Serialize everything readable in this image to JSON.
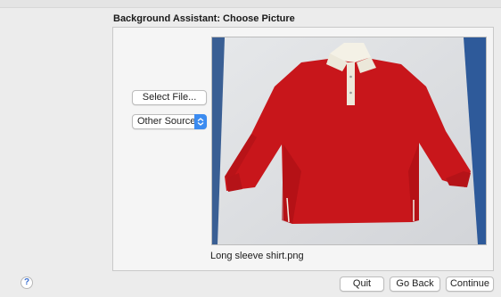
{
  "window": {
    "title": "Background Assistant: Choose Picture"
  },
  "panel": {
    "select_file_label": "Select File...",
    "sources_popup": {
      "selected": "Other Sources",
      "arrow_icon": "chevron-updown-icon"
    },
    "image": {
      "subject": "red long sleeve polo shirt on white background",
      "caption": "Long sleeve shirt.png"
    }
  },
  "footer": {
    "help_label": "?",
    "quit_label": "Quit",
    "go_back_label": "Go Back",
    "continue_label": "Continue"
  },
  "colors": {
    "accent": "#3b8bf0",
    "shirt": "#c8161b",
    "collar": "#f4f1e6"
  }
}
